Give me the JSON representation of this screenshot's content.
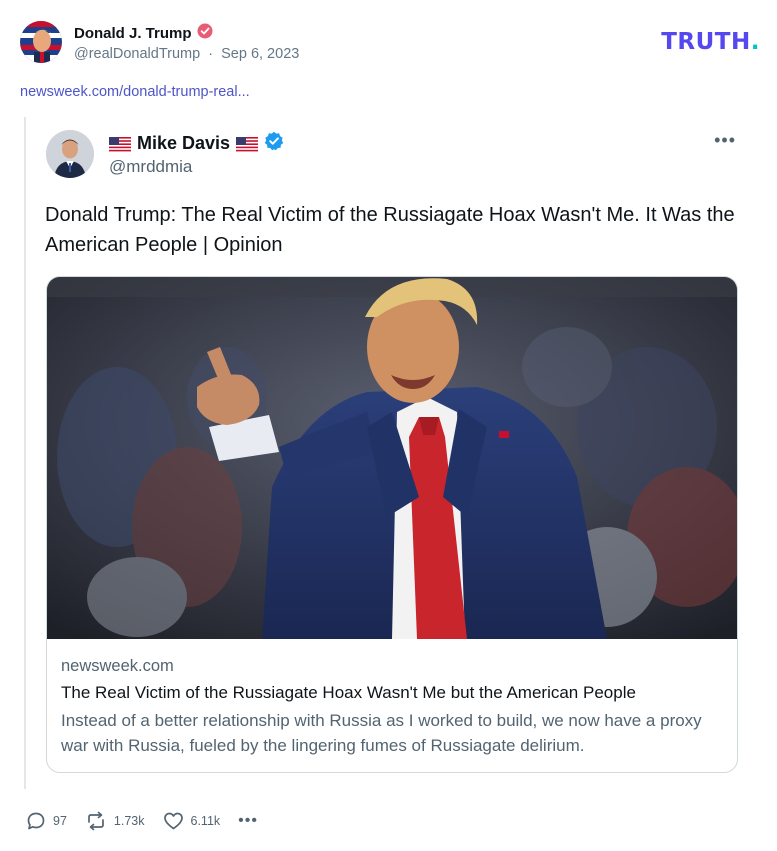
{
  "post": {
    "author_name": "Donald J. Trump",
    "handle": "@realDonaldTrump",
    "separator": "·",
    "date": "Sep 6, 2023",
    "link_text": "newsweek.com/donald-trump-real...",
    "verified_color": "#e85d75"
  },
  "brand": {
    "logo_text": "TRUTH",
    "logo_dot": ".",
    "color": "#5448ee",
    "dot_color": "#00c5c5"
  },
  "tweet": {
    "name": "Mike Davis",
    "handle": "@mrddmia",
    "more_label": "•••",
    "verified_color": "#1d9bf0",
    "text": "Donald Trump: The Real Victim of the Russiagate Hoax Wasn't Me. It Was the American People | Opinion",
    "card": {
      "domain": "newsweek.com",
      "title": "The Real Victim of the Russiagate Hoax Wasn't Me but the American People",
      "description": "Instead of a better relationship with Russia as I worked to build, we now have a proxy war with Russia, fueled by the lingering fumes of Russiagate delirium."
    }
  },
  "actions": {
    "replies": "97",
    "reposts": "1.73k",
    "likes": "6.11k",
    "more_label": "•••"
  }
}
